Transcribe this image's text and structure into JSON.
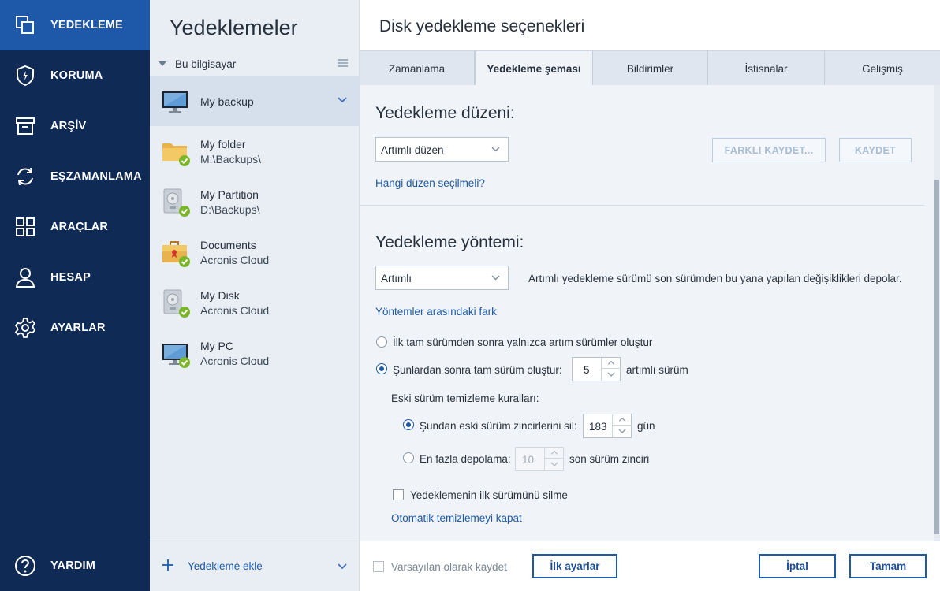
{
  "nav": {
    "items": [
      {
        "label": "YEDEKLEME",
        "icon": "copy-icon"
      },
      {
        "label": "KORUMA",
        "icon": "shield-icon"
      },
      {
        "label": "ARŞİV",
        "icon": "archive-icon"
      },
      {
        "label": "EŞZAMANLAMA",
        "icon": "sync-icon"
      },
      {
        "label": "ARAÇLAR",
        "icon": "grid-icon"
      },
      {
        "label": "HESAP",
        "icon": "user-icon"
      },
      {
        "label": "AYARLAR",
        "icon": "gear-icon"
      }
    ],
    "help": "YARDIM"
  },
  "backups": {
    "title": "Yedeklemeler",
    "group": "Bu bilgisayar",
    "items": [
      {
        "name": "My backup",
        "dest": ""
      },
      {
        "name": "My folder",
        "dest": "M:\\Backups\\"
      },
      {
        "name": "My Partition",
        "dest": "D:\\Backups\\"
      },
      {
        "name": "Documents",
        "dest": "Acronis Cloud"
      },
      {
        "name": "My Disk",
        "dest": "Acronis Cloud"
      },
      {
        "name": "My PC",
        "dest": "Acronis Cloud"
      }
    ],
    "add": "Yedekleme ekle"
  },
  "options": {
    "title": "Disk yedekleme seçenekleri",
    "tabs": [
      "Zamanlama",
      "Yedekleme şeması",
      "Bildirimler",
      "İstisnalar",
      "Gelişmiş"
    ],
    "scheme": {
      "heading": "Yedekleme düzeni:",
      "selected": "Artımlı düzen",
      "save_as": "FARKLI KAYDET...",
      "save": "KAYDET",
      "help_link": "Hangi düzen seçilmeli?"
    },
    "method": {
      "heading": "Yedekleme yöntemi:",
      "selected": "Artımlı",
      "description": "Artımlı yedekleme sürümü son sürümden bu yana yapılan değişiklikleri depolar.",
      "diff_link": "Yöntemler arasındaki fark",
      "radio1": "İlk tam sürümden sonra yalnızca artım sürümler oluştur",
      "radio2": "Şunlardan sonra tam sürüm oluştur:",
      "radio2_value": "5",
      "radio2_suffix": "artımlı sürüm",
      "cleanup_label": "Eski sürüm temizleme kuralları:",
      "cleanup1": "Şundan eski sürüm zincirlerini sil:",
      "cleanup1_value": "183",
      "cleanup1_suffix": "gün",
      "cleanup2": "En fazla depolama:",
      "cleanup2_value": "10",
      "cleanup2_suffix": "son sürüm zinciri",
      "keep_first": "Yedeklemenin ilk sürümünü silme",
      "disable_cleanup": "Otomatik temizlemeyi kapat"
    },
    "footer": {
      "save_default": "Varsayılan olarak kaydet",
      "reset": "İlk ayarlar",
      "cancel": "İptal",
      "ok": "Tamam"
    }
  },
  "colors": {
    "nav_bg": "#0e2a55",
    "nav_active": "#1d59a8",
    "accent": "#1d5aa8",
    "success": "#7bb62a"
  }
}
